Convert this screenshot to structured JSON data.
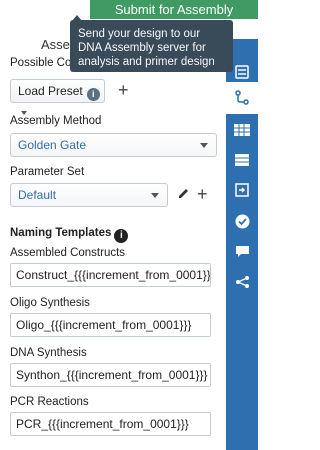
{
  "header": {
    "submit_label": "Submit for Assembly"
  },
  "tooltip": {
    "text": "Send your design to our DNA Assembly server for analysis and primer design"
  },
  "panel": {
    "heading_partial": "Assem",
    "possible_label": "Possible Com",
    "load_preset_label": "Load Preset",
    "info_glyph": "i",
    "plus_glyph": "+",
    "assembly_method_label": "Assembly Method",
    "assembly_method_value": "Golden Gate",
    "parameter_set_label": "Parameter Set",
    "parameter_set_value": "Default",
    "naming_templates_title": "Naming Templates",
    "fields": [
      {
        "label": "Assembled Constructs",
        "value": "Construct_{{{increment_from_0001}}}"
      },
      {
        "label": "Oligo Synthesis",
        "value": "Oligo_{{{increment_from_0001}}}"
      },
      {
        "label": "DNA Synthesis",
        "value": "Synthon_{{{increment_from_0001}}}"
      },
      {
        "label": "PCR Reactions",
        "value": "PCR_{{{increment_from_0001}}}"
      }
    ]
  },
  "rail": {
    "items": [
      {
        "icon": "list-icon"
      },
      {
        "icon": "branch-icon",
        "active": true
      },
      {
        "icon": "grid-icon"
      },
      {
        "icon": "table-icon"
      },
      {
        "icon": "import-icon"
      },
      {
        "icon": "check-circle-icon"
      },
      {
        "icon": "comment-icon"
      },
      {
        "icon": "share-icon"
      }
    ]
  },
  "colors": {
    "submit_green": "#3f9a63",
    "rail_blue": "#2e6fb0",
    "tooltip_bg": "#394b59",
    "select_text": "#2e6fa8"
  }
}
